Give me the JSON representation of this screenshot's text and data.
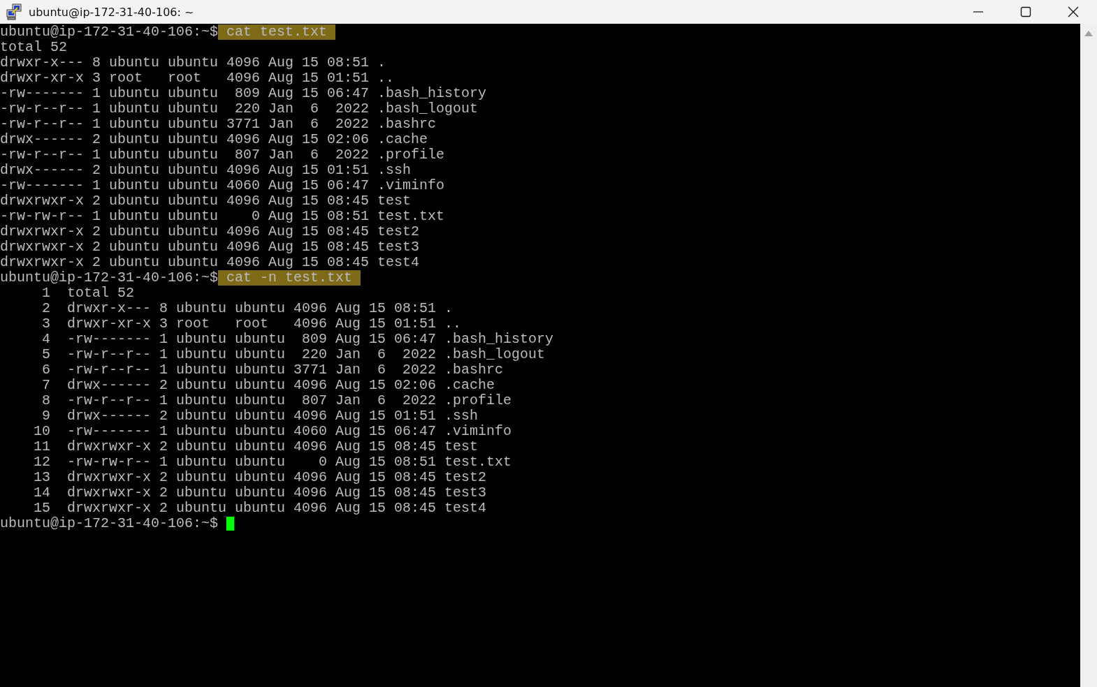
{
  "window": {
    "title": "ubuntu@ip-172-31-40-106: ~"
  },
  "terminal": {
    "lines": [
      {
        "kind": "prompt",
        "prompt": "ubuntu@ip-172-31-40-106:~$",
        "command": "cat test.txt",
        "highlighted": true
      },
      {
        "kind": "output",
        "text": "total 52"
      },
      {
        "kind": "output",
        "text": "drwxr-x--- 8 ubuntu ubuntu 4096 Aug 15 08:51 ."
      },
      {
        "kind": "output",
        "text": "drwxr-xr-x 3 root   root   4096 Aug 15 01:51 .."
      },
      {
        "kind": "output",
        "text": "-rw------- 1 ubuntu ubuntu  809 Aug 15 06:47 .bash_history"
      },
      {
        "kind": "output",
        "text": "-rw-r--r-- 1 ubuntu ubuntu  220 Jan  6  2022 .bash_logout"
      },
      {
        "kind": "output",
        "text": "-rw-r--r-- 1 ubuntu ubuntu 3771 Jan  6  2022 .bashrc"
      },
      {
        "kind": "output",
        "text": "drwx------ 2 ubuntu ubuntu 4096 Aug 15 02:06 .cache"
      },
      {
        "kind": "output",
        "text": "-rw-r--r-- 1 ubuntu ubuntu  807 Jan  6  2022 .profile"
      },
      {
        "kind": "output",
        "text": "drwx------ 2 ubuntu ubuntu 4096 Aug 15 01:51 .ssh"
      },
      {
        "kind": "output",
        "text": "-rw------- 1 ubuntu ubuntu 4060 Aug 15 06:47 .viminfo"
      },
      {
        "kind": "output",
        "text": "drwxrwxr-x 2 ubuntu ubuntu 4096 Aug 15 08:45 test"
      },
      {
        "kind": "output",
        "text": "-rw-rw-r-- 1 ubuntu ubuntu    0 Aug 15 08:51 test.txt"
      },
      {
        "kind": "output",
        "text": "drwxrwxr-x 2 ubuntu ubuntu 4096 Aug 15 08:45 test2"
      },
      {
        "kind": "output",
        "text": "drwxrwxr-x 2 ubuntu ubuntu 4096 Aug 15 08:45 test3"
      },
      {
        "kind": "output",
        "text": "drwxrwxr-x 2 ubuntu ubuntu 4096 Aug 15 08:45 test4"
      },
      {
        "kind": "prompt",
        "prompt": "ubuntu@ip-172-31-40-106:~$",
        "command": "cat -n test.txt",
        "highlighted": true
      },
      {
        "kind": "numbered",
        "number": "1",
        "text": "total 52"
      },
      {
        "kind": "numbered",
        "number": "2",
        "text": "drwxr-x--- 8 ubuntu ubuntu 4096 Aug 15 08:51 ."
      },
      {
        "kind": "numbered",
        "number": "3",
        "text": "drwxr-xr-x 3 root   root   4096 Aug 15 01:51 .."
      },
      {
        "kind": "numbered",
        "number": "4",
        "text": "-rw------- 1 ubuntu ubuntu  809 Aug 15 06:47 .bash_history"
      },
      {
        "kind": "numbered",
        "number": "5",
        "text": "-rw-r--r-- 1 ubuntu ubuntu  220 Jan  6  2022 .bash_logout"
      },
      {
        "kind": "numbered",
        "number": "6",
        "text": "-rw-r--r-- 1 ubuntu ubuntu 3771 Jan  6  2022 .bashrc"
      },
      {
        "kind": "numbered",
        "number": "7",
        "text": "drwx------ 2 ubuntu ubuntu 4096 Aug 15 02:06 .cache"
      },
      {
        "kind": "numbered",
        "number": "8",
        "text": "-rw-r--r-- 1 ubuntu ubuntu  807 Jan  6  2022 .profile"
      },
      {
        "kind": "numbered",
        "number": "9",
        "text": "drwx------ 2 ubuntu ubuntu 4096 Aug 15 01:51 .ssh"
      },
      {
        "kind": "numbered",
        "number": "10",
        "text": "-rw------- 1 ubuntu ubuntu 4060 Aug 15 06:47 .viminfo"
      },
      {
        "kind": "numbered",
        "number": "11",
        "text": "drwxrwxr-x 2 ubuntu ubuntu 4096 Aug 15 08:45 test"
      },
      {
        "kind": "numbered",
        "number": "12",
        "text": "-rw-rw-r-- 1 ubuntu ubuntu    0 Aug 15 08:51 test.txt"
      },
      {
        "kind": "numbered",
        "number": "13",
        "text": "drwxrwxr-x 2 ubuntu ubuntu 4096 Aug 15 08:45 test2"
      },
      {
        "kind": "numbered",
        "number": "14",
        "text": "drwxrwxr-x 2 ubuntu ubuntu 4096 Aug 15 08:45 test3"
      },
      {
        "kind": "numbered",
        "number": "15",
        "text": "drwxrwxr-x 2 ubuntu ubuntu 4096 Aug 15 08:45 test4"
      },
      {
        "kind": "prompt",
        "prompt": "ubuntu@ip-172-31-40-106:~$",
        "cursor": true
      }
    ]
  }
}
